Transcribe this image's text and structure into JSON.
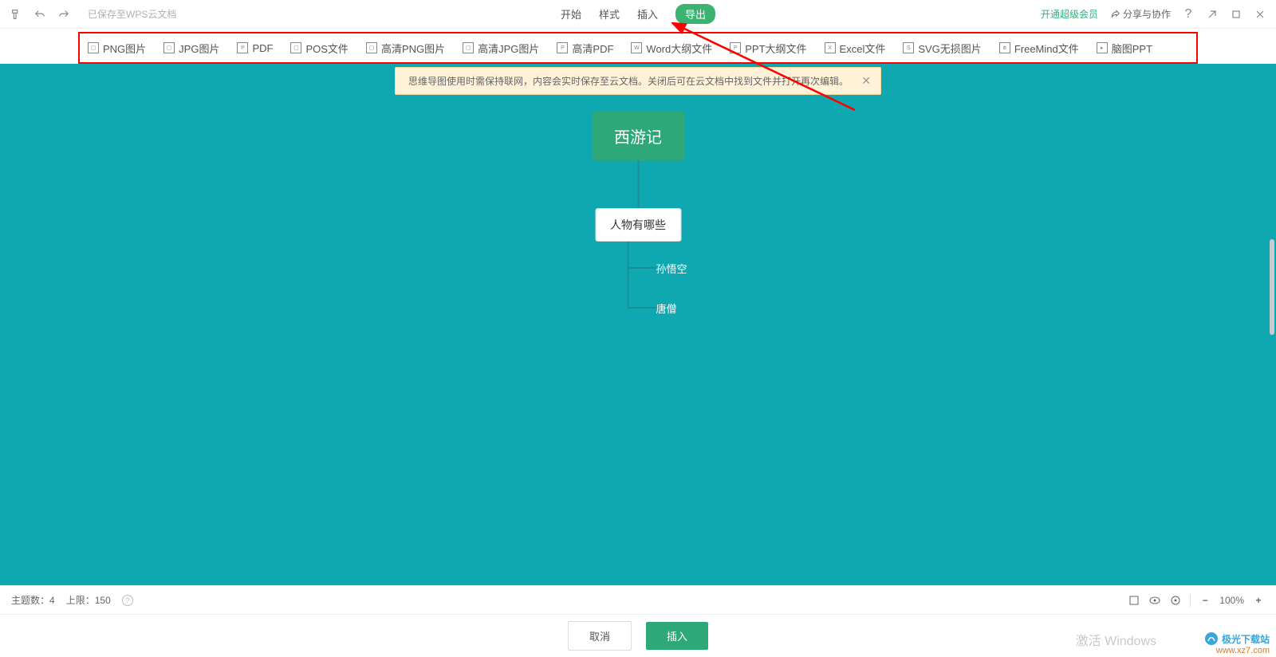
{
  "header": {
    "save_status": "已保存至WPS云文档",
    "tabs": {
      "start": "开始",
      "style": "样式",
      "insert": "插入",
      "export": "导出"
    },
    "vip": "开通超级会员",
    "share": "分享与协作"
  },
  "export": {
    "items": [
      "PNG图片",
      "JPG图片",
      "PDF",
      "POS文件",
      "高清PNG图片",
      "高清JPG图片",
      "高清PDF",
      "Word大纲文件",
      "PPT大纲文件",
      "Excel文件",
      "SVG无损图片",
      "FreeMind文件",
      "脑图PPT"
    ]
  },
  "message": "思维导图使用时需保持联网，内容会实时保存至云文档。关闭后可在云文档中找到文件并打开再次编辑。",
  "mindmap": {
    "root": "西游记",
    "child": "人物有哪些",
    "subs": [
      "孙悟空",
      "唐僧"
    ]
  },
  "status": {
    "topic_count_label": "主题数：",
    "topic_count": "4",
    "limit_label": "上限：",
    "limit": "150",
    "zoom": "100%"
  },
  "buttons": {
    "cancel": "取消",
    "insert": "插入"
  },
  "watermark": {
    "brand": "极光下载站",
    "url": "www.xz7.com",
    "activate": "激活 Windows"
  }
}
